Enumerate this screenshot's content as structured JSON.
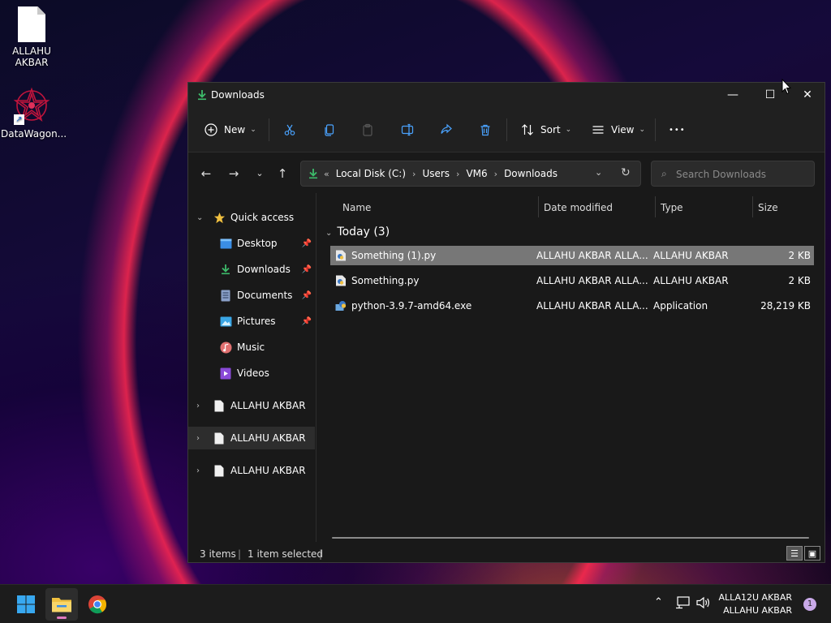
{
  "desktop": {
    "icons": [
      {
        "label": "ALLAHU AKBAR"
      },
      {
        "label": "DataWagon..."
      }
    ]
  },
  "window": {
    "title": "Downloads",
    "controls": {
      "minimize": "—",
      "maximize": "☐",
      "close": "✕"
    }
  },
  "toolbar": {
    "new_label": "New",
    "sort_label": "Sort",
    "view_label": "View",
    "more_label": "•••"
  },
  "nav": {
    "breadcrumbs": [
      "Local Disk (C:)",
      "Users",
      "VM6",
      "Downloads"
    ],
    "overflow": "«",
    "search_placeholder": "Search Downloads"
  },
  "sidebar": {
    "quick_access": "Quick access",
    "items": [
      {
        "label": "Desktop",
        "icon": "desktop-icon"
      },
      {
        "label": "Downloads",
        "icon": "download-icon"
      },
      {
        "label": "Documents",
        "icon": "documents-icon"
      },
      {
        "label": "Pictures",
        "icon": "pictures-icon"
      },
      {
        "label": "Music",
        "icon": "music-icon"
      },
      {
        "label": "Videos",
        "icon": "videos-icon"
      }
    ],
    "drives": [
      {
        "label": "ALLAHU AKBAR"
      },
      {
        "label": "ALLAHU AKBAR"
      },
      {
        "label": "ALLAHU AKBAR"
      }
    ]
  },
  "columns": {
    "name": "Name",
    "date": "Date modified",
    "type": "Type",
    "size": "Size"
  },
  "group": {
    "label": "Today (3)"
  },
  "files": [
    {
      "name": "Something (1).py",
      "date": "ALLAHU AKBAR ALLA...",
      "type": "ALLAHU AKBAR",
      "size": "2 KB"
    },
    {
      "name": "Something.py",
      "date": "ALLAHU AKBAR ALLA...",
      "type": "ALLAHU AKBAR",
      "size": "2 KB"
    },
    {
      "name": "python-3.9.7-amd64.exe",
      "date": "ALLAHU AKBAR ALLA...",
      "type": "Application",
      "size": "28,219 KB"
    }
  ],
  "status": {
    "items": "3 items",
    "selected": "1 item selected"
  },
  "taskbar": {
    "clock_line1": "ALLA12U AKBAR",
    "clock_line2": "ALLAHU AKBAR",
    "notification_count": "1"
  },
  "colors": {
    "accent": "#3dbb6a",
    "folder": "#f0c040",
    "selection": "#777777"
  }
}
